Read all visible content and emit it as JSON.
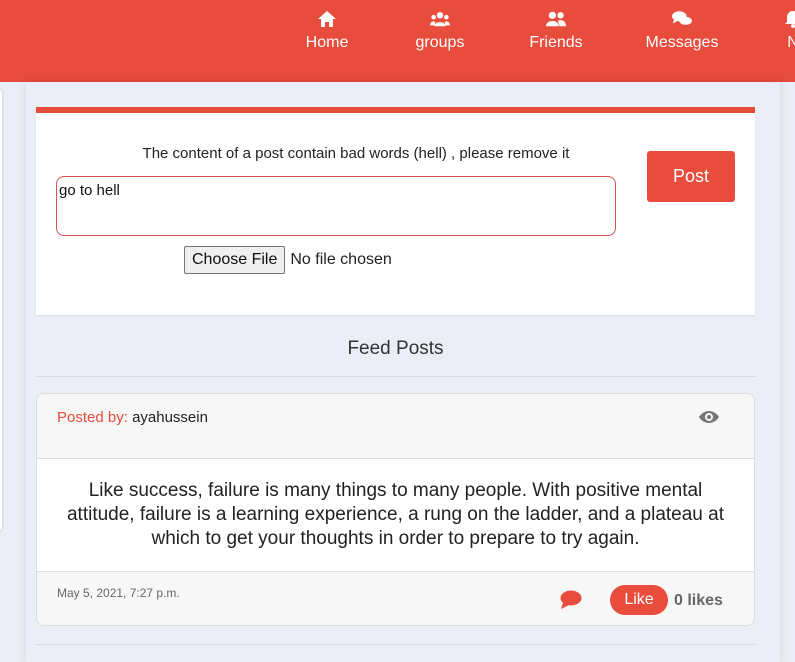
{
  "nav": {
    "items": [
      {
        "label": "Home",
        "icon": "home-icon"
      },
      {
        "label": "groups",
        "icon": "groups-icon"
      },
      {
        "label": "Friends",
        "icon": "friends-icon"
      },
      {
        "label": "Messages",
        "icon": "messages-icon"
      },
      {
        "label": "N",
        "icon": "bell-icon"
      }
    ],
    "color": "#e74c3c"
  },
  "post_form": {
    "error_message": "The content of a post contain bad words (hell) , please remove it",
    "textarea_value": "go to hell",
    "file_button_label": "Choose File",
    "file_status": "No file chosen",
    "post_button_label": "Post"
  },
  "feed": {
    "title": "Feed Posts",
    "posts": [
      {
        "posted_by_label": "Posted by:",
        "author": "ayahussein",
        "content": "Like success, failure is many things to many people. With positive mental attitude, failure is a learning experience, a rung on the ladder, and a plateau at which to get your thoughts in order to prepare to try again.",
        "timestamp": "May 5, 2021, 7:27 p.m.",
        "like_button_label": "Like",
        "likes_text": "0 likes"
      }
    ]
  },
  "colors": {
    "accent": "#e74c3c",
    "background": "#eceef7"
  }
}
